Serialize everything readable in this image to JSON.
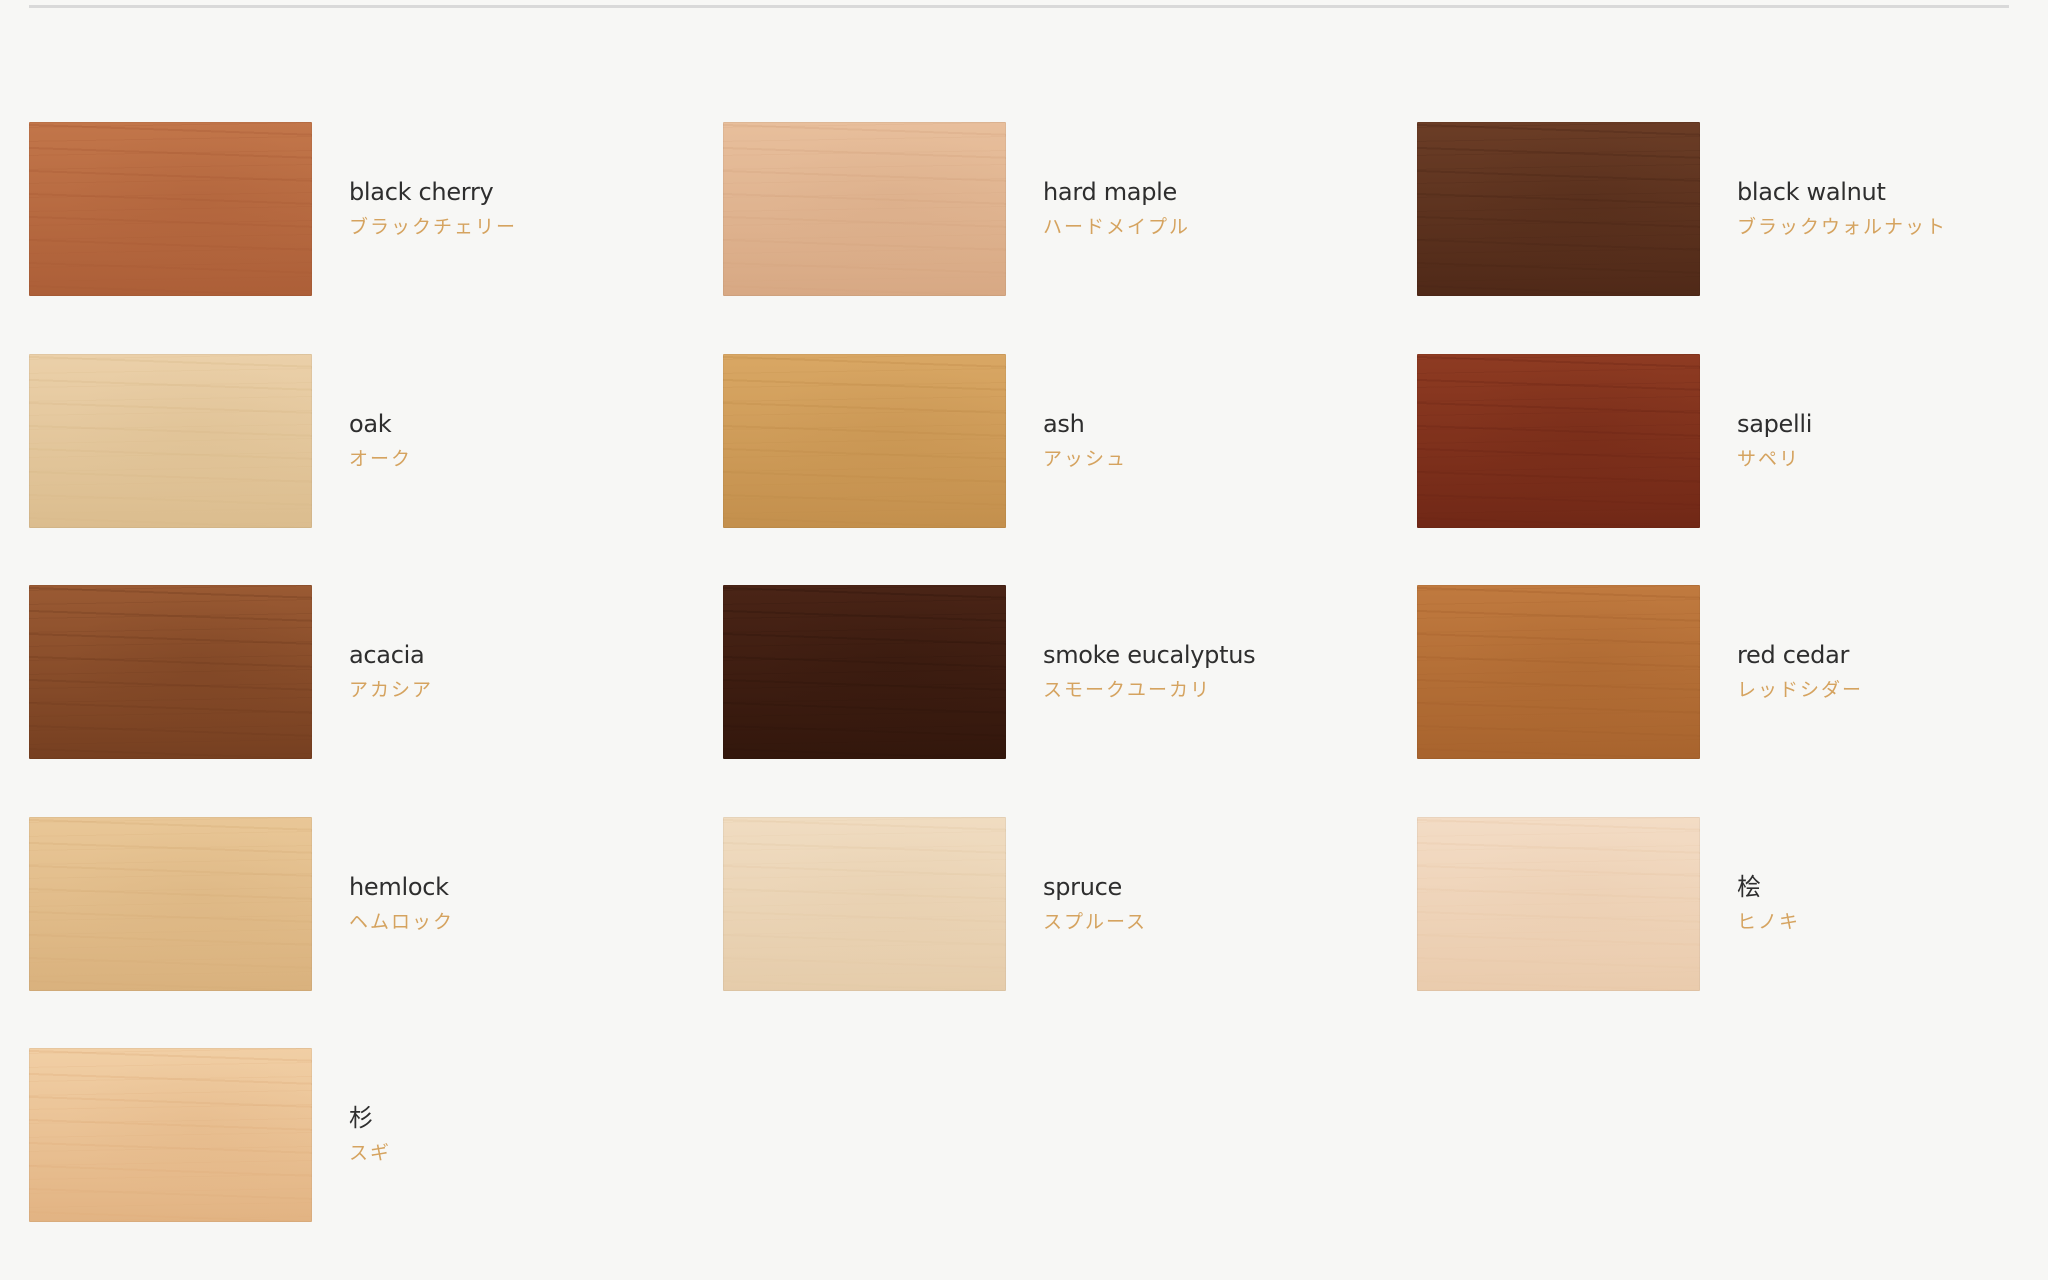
{
  "woods": [
    {
      "name": "black cherry",
      "kana": "ブラックチェリー",
      "icon": "black-cherry-wood-swatch",
      "base": "#c2764a",
      "grain": "#a85a34"
    },
    {
      "name": "hard maple",
      "kana": "ハードメイプル",
      "icon": "hard-maple-wood-swatch",
      "base": "#e8bf9c",
      "grain": "#d4a47f"
    },
    {
      "name": "black walnut",
      "kana": "ブラックウォルナット",
      "icon": "black-walnut-wood-swatch",
      "base": "#6b3d26",
      "grain": "#4a2515"
    },
    {
      "name": "oak",
      "kana": "オーク",
      "icon": "oak-wood-swatch",
      "base": "#ebd0a9",
      "grain": "#d8b989"
    },
    {
      "name": "ash",
      "kana": "アッシュ",
      "icon": "ash-wood-swatch",
      "base": "#d9a764",
      "grain": "#bf8b48"
    },
    {
      "name": "sapelli",
      "kana": "サペリ",
      "icon": "sapelli-wood-swatch",
      "base": "#8e3b22",
      "grain": "#6b2414"
    },
    {
      "name": "acacia",
      "kana": "アカシア",
      "icon": "acacia-wood-swatch",
      "base": "#9a5a33",
      "grain": "#6f3a1d"
    },
    {
      "name": "smoke eucalyptus",
      "kana": "スモークユーカリ",
      "icon": "smoke-eucalyptus-wood-swatch",
      "base": "#4a2416",
      "grain": "#2e140a"
    },
    {
      "name": "red cedar",
      "kana": "レッドシダー",
      "icon": "red-cedar-wood-swatch",
      "base": "#c07a3f",
      "grain": "#a35f2a"
    },
    {
      "name": "hemlock",
      "kana": "ヘムロック",
      "icon": "hemlock-wood-swatch",
      "base": "#e9c797",
      "grain": "#d6ad78"
    },
    {
      "name": "spruce",
      "kana": "スプルース",
      "icon": "spruce-wood-swatch",
      "base": "#f0dcc1",
      "grain": "#e3c9a6"
    },
    {
      "name": "桧",
      "kana": "ヒノキ",
      "icon": "hinoki-wood-swatch",
      "base": "#f3dcc5",
      "grain": "#e8c8a8"
    },
    {
      "name": "杉",
      "kana": "スギ",
      "icon": "sugi-wood-swatch",
      "base": "#f1cfa5",
      "grain": "#dfae7c"
    }
  ]
}
